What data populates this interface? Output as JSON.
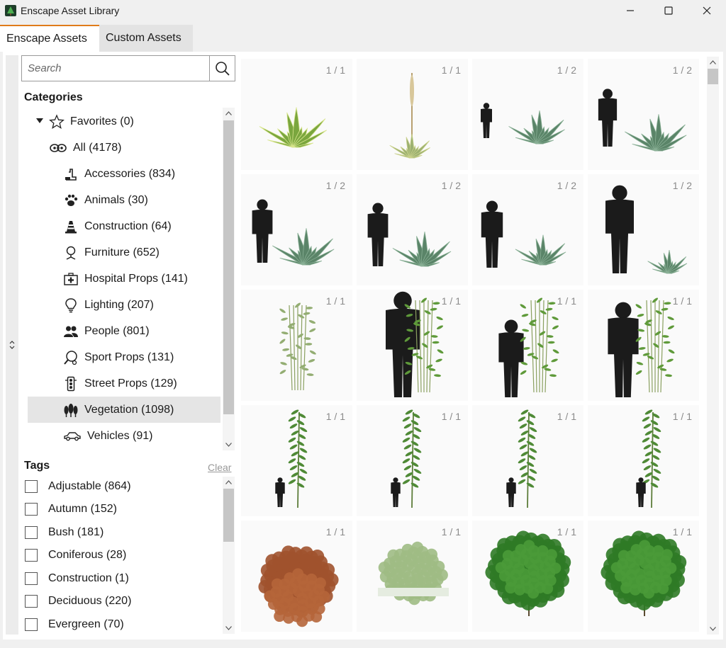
{
  "window": {
    "title": "Enscape Asset Library",
    "controls": [
      "minimize",
      "maximize",
      "close"
    ]
  },
  "tabs": [
    {
      "label": "Enscape Assets",
      "active": true
    },
    {
      "label": "Custom Assets",
      "active": false
    }
  ],
  "search": {
    "placeholder": "Search",
    "value": ""
  },
  "categories": {
    "title": "Categories",
    "favorites": {
      "label": "Favorites (0)",
      "icon": "star-icon"
    },
    "all": {
      "label": "All (4178)",
      "icon": "infinity-icon",
      "expanded": true
    },
    "items": [
      {
        "label": "Accessories (834)",
        "icon": "accessories-icon"
      },
      {
        "label": "Animals (30)",
        "icon": "paw-icon"
      },
      {
        "label": "Construction (64)",
        "icon": "traffic-cone-icon"
      },
      {
        "label": "Furniture (652)",
        "icon": "chair-icon"
      },
      {
        "label": "Hospital Props (141)",
        "icon": "first-aid-icon"
      },
      {
        "label": "Lighting (207)",
        "icon": "lightbulb-icon"
      },
      {
        "label": "People (801)",
        "icon": "people-icon"
      },
      {
        "label": "Sport Props (131)",
        "icon": "sport-icon"
      },
      {
        "label": "Street Props (129)",
        "icon": "traffic-light-icon"
      },
      {
        "label": "Vegetation (1098)",
        "icon": "trees-icon",
        "selected": true
      },
      {
        "label": "Vehicles (91)",
        "icon": "car-icon"
      }
    ]
  },
  "tags": {
    "title": "Tags",
    "clear_label": "Clear",
    "items": [
      {
        "label": "Adjustable (864)",
        "checked": false
      },
      {
        "label": "Autumn (152)",
        "checked": false
      },
      {
        "label": "Bush (181)",
        "checked": false
      },
      {
        "label": "Coniferous (28)",
        "checked": false
      },
      {
        "label": "Construction (1)",
        "checked": false
      },
      {
        "label": "Deciduous (220)",
        "checked": false
      },
      {
        "label": "Evergreen (70)",
        "checked": false
      }
    ]
  },
  "assets": [
    {
      "count": "1 / 1",
      "kind": "agave-variegated"
    },
    {
      "count": "1 / 1",
      "kind": "yucca-flowering"
    },
    {
      "count": "1 / 2",
      "kind": "agave-with-person"
    },
    {
      "count": "1 / 2",
      "kind": "agave-with-person"
    },
    {
      "count": "1 / 2",
      "kind": "agave-with-person"
    },
    {
      "count": "1 / 2",
      "kind": "agave-with-person"
    },
    {
      "count": "1 / 2",
      "kind": "agave-with-person"
    },
    {
      "count": "1 / 2",
      "kind": "agave-with-person"
    },
    {
      "count": "1 / 1",
      "kind": "bamboo-shrub"
    },
    {
      "count": "1 / 1",
      "kind": "bamboo-with-person"
    },
    {
      "count": "1 / 1",
      "kind": "bamboo-with-person"
    },
    {
      "count": "1 / 1",
      "kind": "bamboo-with-person"
    },
    {
      "count": "1 / 1",
      "kind": "tall-bamboo-with-person"
    },
    {
      "count": "1 / 1",
      "kind": "tall-bamboo-with-person"
    },
    {
      "count": "1 / 1",
      "kind": "tall-bamboo-with-person"
    },
    {
      "count": "1 / 1",
      "kind": "tall-bamboo-with-person"
    },
    {
      "count": "1 / 1",
      "kind": "autumn-shrub"
    },
    {
      "count": "1 / 1",
      "kind": "low-shrub"
    },
    {
      "count": "1 / 1",
      "kind": "green-bush"
    },
    {
      "count": "1 / 1",
      "kind": "green-bush"
    }
  ],
  "colors": {
    "accent": "#e07b1a",
    "selected_row": "#e5e5e5",
    "plant_green": "#4f7a3a",
    "silhouette": "#1b1b1b",
    "autumn": "#a0522d"
  }
}
